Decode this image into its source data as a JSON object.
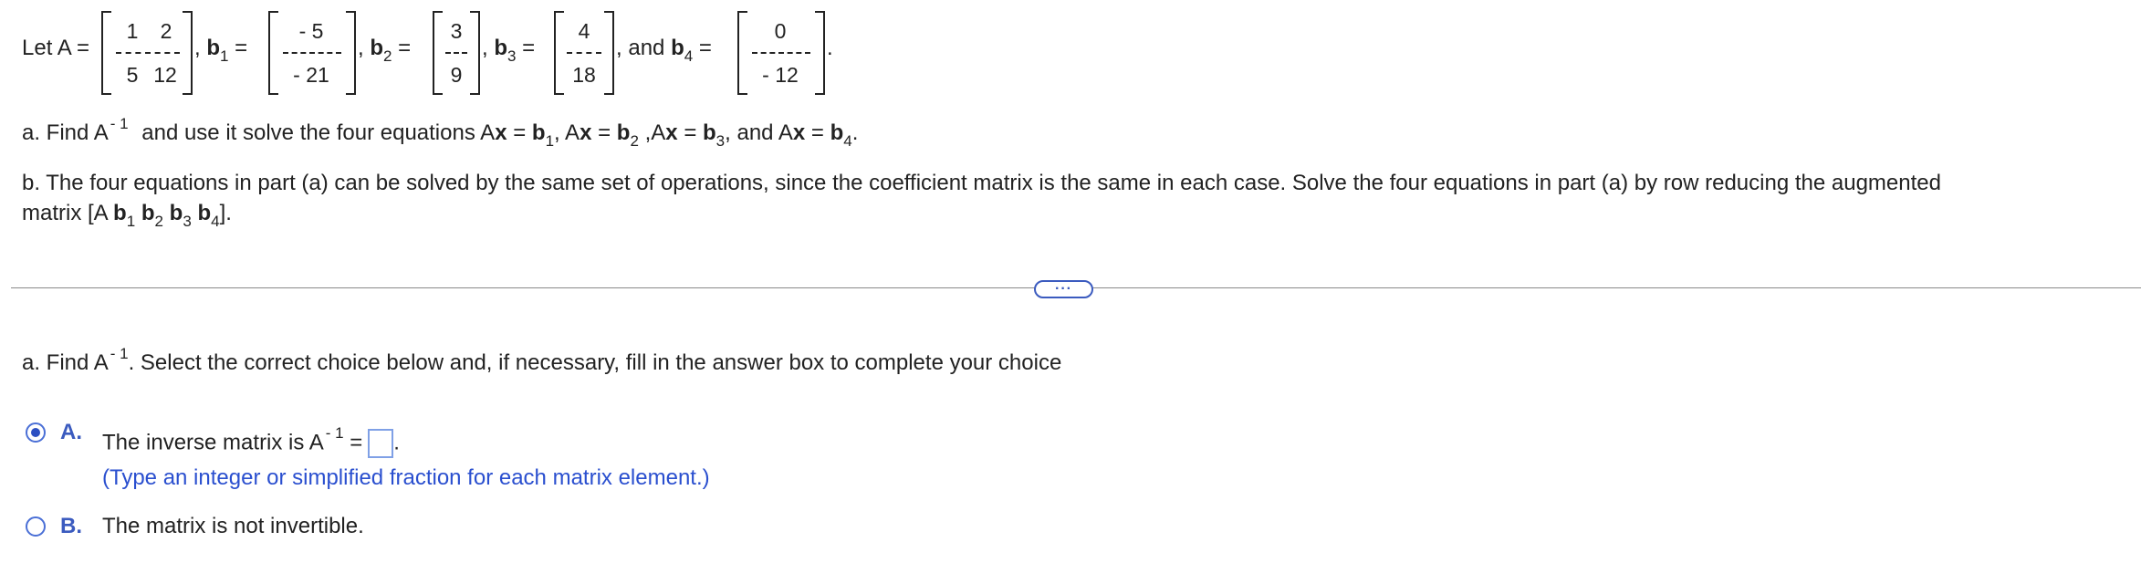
{
  "problem": {
    "let_label": "Let A =",
    "matrix_A": [
      [
        "1",
        "2"
      ],
      [
        "5",
        "12"
      ]
    ],
    "b1_label": "b",
    "b1_sub": "1",
    "b1_values": [
      "- 5",
      "- 21"
    ],
    "b2_label": "b",
    "b2_sub": "2",
    "b2_values": [
      "3",
      "9"
    ],
    "b3_label": "b",
    "b3_sub": "3",
    "b3_values": [
      "4",
      "18"
    ],
    "and_text": "and",
    "b4_label": "b",
    "b4_sub": "4",
    "b4_values": [
      "0",
      "- 12"
    ],
    "equals": "=",
    "comma": ",",
    "period": ".",
    "part_a_prefix": "a. Find A",
    "inverse_sup": "- 1",
    "part_a_rest": "and use it solve the four equations A",
    "x": "x",
    "eq": "=",
    "part_a_sep1": ", A",
    "part_a_sep2": " ,A",
    "part_a_sep3": ", and A",
    "part_b_line1": "b. The four equations in part (a) can be solved by the same set of operations, since the coefficient matrix is the same in each case. Solve the four equations in part (a) by row reducing the augmented",
    "part_b_line2_prefix": "matrix [A ",
    "part_b_line2_suffix": "]."
  },
  "divider": {
    "dots": "···"
  },
  "question": {
    "prompt_prefix": "a. Find A",
    "prompt_sup": "- 1",
    "prompt_rest": ". Select the correct choice below and, if necessary, fill in the answer box to complete your choice",
    "choice_a_letter": "A.",
    "choice_a_text": "The inverse matrix is A",
    "choice_a_sup": "- 1",
    "choice_a_eq": "=",
    "choice_a_period": ".",
    "choice_a_hint": "(Type an integer or simplified fraction for each matrix element.)",
    "choice_b_letter": "B.",
    "choice_b_text": "The matrix is not invertible.",
    "selected_choice": "A"
  },
  "colors": {
    "accent": "#3b5bbf",
    "hint": "#2a4fcf",
    "text": "#222222"
  }
}
